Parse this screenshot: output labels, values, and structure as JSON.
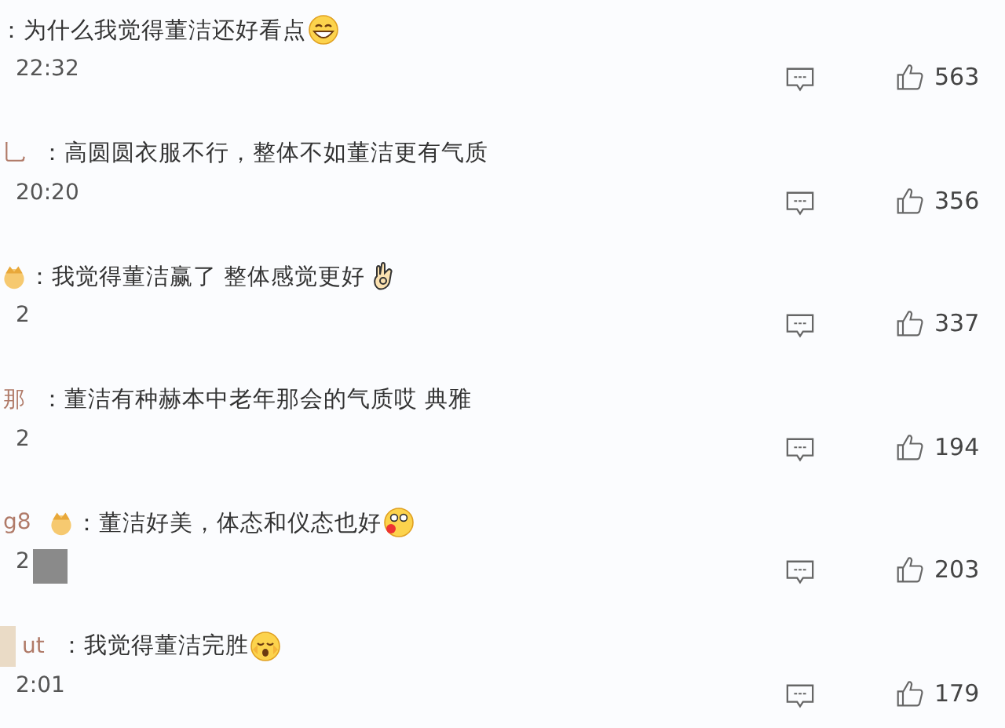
{
  "comments": [
    {
      "text": "：为什么我觉得董洁还好看点",
      "emoji": {
        "kind": "grin"
      },
      "time": "22:32",
      "likes": "563"
    },
    {
      "user": "乚",
      "text": "：高圆圆衣服不行，整体不如董洁更有气质",
      "time": "20:20",
      "likes": "356"
    },
    {
      "badge": true,
      "text": "：我觉得董洁赢了 整体感觉更好",
      "emoji": {
        "kind": "hand"
      },
      "time": "2",
      "likes": "337"
    },
    {
      "user": "那",
      "text": "：董洁有种赫本中老年那会的气质哎 典雅",
      "time": "2",
      "likes": "194"
    },
    {
      "user": "g8",
      "badge": true,
      "text": "：董洁好美，体态和仪态也好",
      "emoji": {
        "kind": "tongue"
      },
      "time": "2",
      "redaction": {
        "kind": "under-time"
      },
      "likes": "203"
    },
    {
      "user": "ut",
      "text": "：我觉得董洁完胜",
      "emoji": {
        "kind": "shocked"
      },
      "time": "2:01",
      "redaction": {
        "kind": "before-name"
      },
      "likes": "179"
    }
  ]
}
